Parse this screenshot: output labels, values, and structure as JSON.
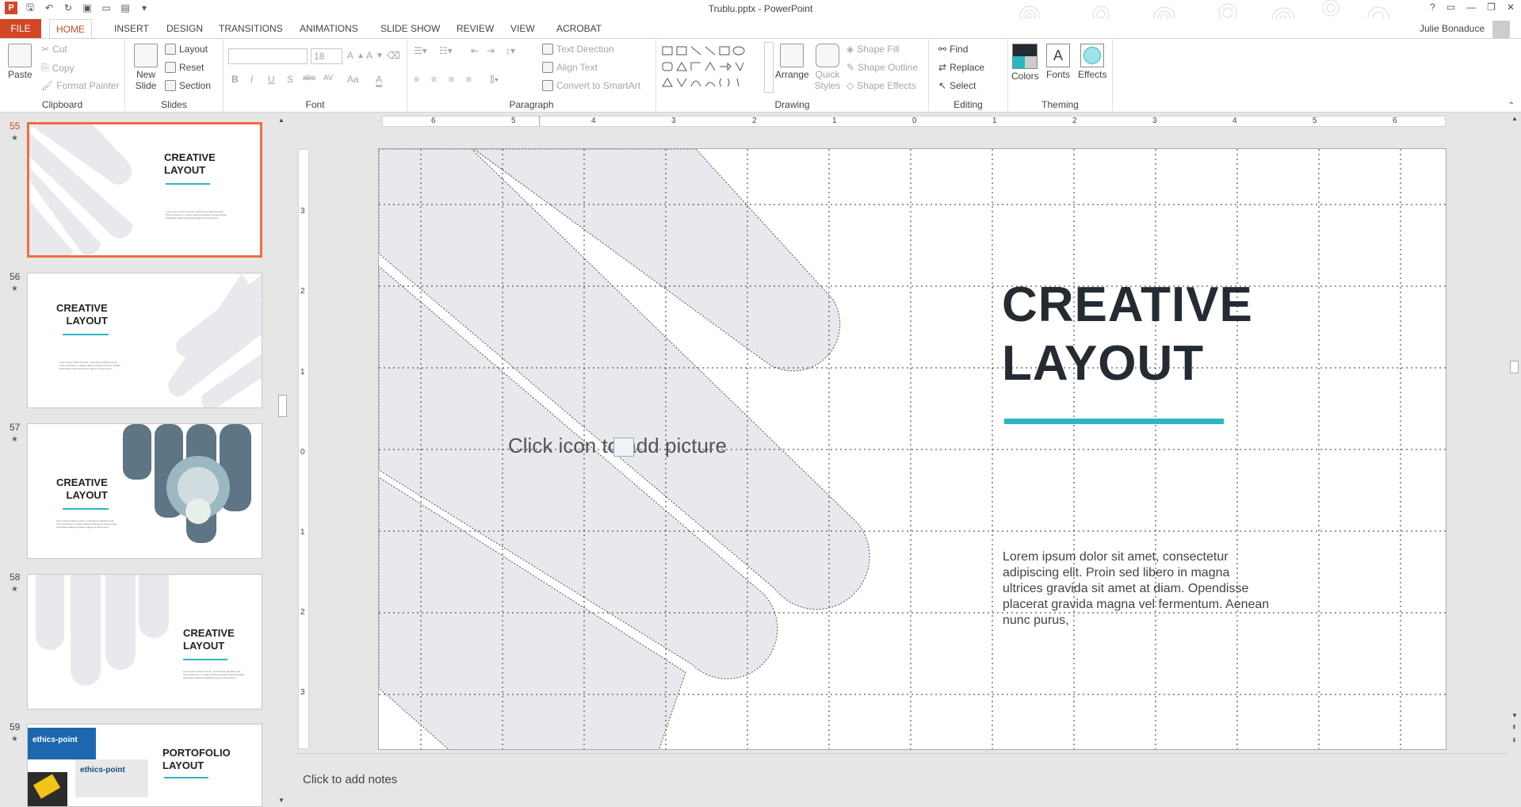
{
  "window": {
    "title": "Trublu.pptx - PowerPoint",
    "user": "Julie Bonaduce",
    "controls": [
      "?",
      "▭",
      "—",
      "❐",
      "✕"
    ]
  },
  "colors": {
    "accent": "#d24726",
    "selection": "#f26b43",
    "teal": "#2bb6c4",
    "shape_fill": "#e7e9ec",
    "title_dark": "#242b33"
  },
  "tabs": [
    "FILE",
    "HOME",
    "INSERT",
    "DESIGN",
    "TRANSITIONS",
    "ANIMATIONS",
    "SLIDE SHOW",
    "REVIEW",
    "VIEW",
    "ACROBAT"
  ],
  "ribbon": {
    "clipboard": {
      "paste": "Paste",
      "cut": "Cut",
      "copy": "Copy",
      "format_painter": "Format Painter",
      "label": "Clipboard"
    },
    "slides": {
      "new_slide": "New Slide",
      "layout": "Layout",
      "reset": "Reset",
      "section": "Section",
      "label": "Slides"
    },
    "font": {
      "size": "18",
      "label": "Font",
      "bold": "B",
      "italic": "I",
      "underline": "U",
      "shadow": "S",
      "strike": "abc",
      "spacing": "AV",
      "case": "Aa",
      "color": "A"
    },
    "paragraph": {
      "text_direction": "Text Direction",
      "align_text": "Align Text",
      "convert_smartart": "Convert to SmartArt",
      "label": "Paragraph"
    },
    "drawing": {
      "arrange": "Arrange",
      "quick_styles": "Quick Styles",
      "shape_fill": "Shape Fill",
      "shape_outline": "Shape Outline",
      "shape_effects": "Shape Effects",
      "label": "Drawing"
    },
    "editing": {
      "find": "Find",
      "replace": "Replace",
      "select": "Select",
      "label": "Editing"
    },
    "theming": {
      "colors": "Colors",
      "fonts": "Fonts",
      "effects": "Effects",
      "label": "Theming"
    }
  },
  "thumbnails": [
    {
      "num": "55",
      "title_line1": "CREATIVE",
      "title_line2": "LAYOUT",
      "selected": true
    },
    {
      "num": "56",
      "title_line1": "CREATIVE",
      "title_line2": "LAYOUT"
    },
    {
      "num": "57",
      "title_line1": "CREATIVE",
      "title_line2": "LAYOUT"
    },
    {
      "num": "58",
      "title_line1": "CREATIVE",
      "title_line2": "LAYOUT"
    },
    {
      "num": "59",
      "title_line1": "PORTOFOLIO",
      "title_line2": "LAYOUT",
      "logo1": "ethics-point",
      "logo2": "ethics-point"
    }
  ],
  "thumb_body": "Lorem ipsum dolor sit amet, consectetur adipiscing elit. Proin sed libero in magna ultrices gravida sit amet at diam. Opendisse placerat gravida magna vel fermentum.",
  "ruler": {
    "h": [
      "6",
      "5",
      "4",
      "3",
      "2",
      "1",
      "0",
      "1",
      "2",
      "3",
      "4",
      "5",
      "6"
    ],
    "v": [
      "3",
      "2",
      "1",
      "0",
      "1",
      "2",
      "3"
    ]
  },
  "slide": {
    "title_line1": "CREATIVE",
    "title_line2": "LAYOUT",
    "placeholder": "Click icon to add picture",
    "body": "Lorem ipsum dolor sit amet, consectetur adipiscing elit. Proin sed libero in magna ultrices gravida sit amet at diam. Opendisse placerat gravida magna vel fermentum. Aenean nunc purus,"
  },
  "notes": {
    "placeholder": "Click to add notes"
  }
}
